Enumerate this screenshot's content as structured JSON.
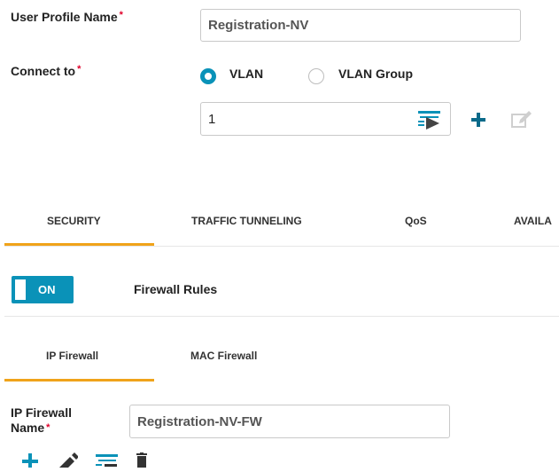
{
  "profile": {
    "name_label": "User Profile Name",
    "name_required": "*",
    "name_value": "Registration-NV"
  },
  "connect": {
    "label": "Connect to",
    "required": "*",
    "options": [
      "VLAN",
      "VLAN Group"
    ],
    "selected": "VLAN",
    "vlan_value": "1"
  },
  "tabs": {
    "items": [
      "SECURITY",
      "TRAFFIC TUNNELING",
      "QoS",
      "AVAILA"
    ],
    "active": "SECURITY"
  },
  "firewall": {
    "toggle_label": "ON",
    "rules_label": "Firewall Rules",
    "subtabs": [
      "IP Firewall",
      "MAC Firewall"
    ],
    "active_subtab": "IP Firewall",
    "ip_name_label_line1": "IP Firewall",
    "ip_name_label_line2": "Name",
    "ip_name_required": "*",
    "ip_name_value": "Registration-NV-FW"
  },
  "colors": {
    "accent": "#0a92b8",
    "tab_underline": "#f0a31a",
    "required": "#e0002a"
  },
  "icons": [
    "list-select-icon",
    "plus-icon",
    "edit-icon",
    "pencil-icon",
    "list-icon",
    "trash-icon"
  ]
}
